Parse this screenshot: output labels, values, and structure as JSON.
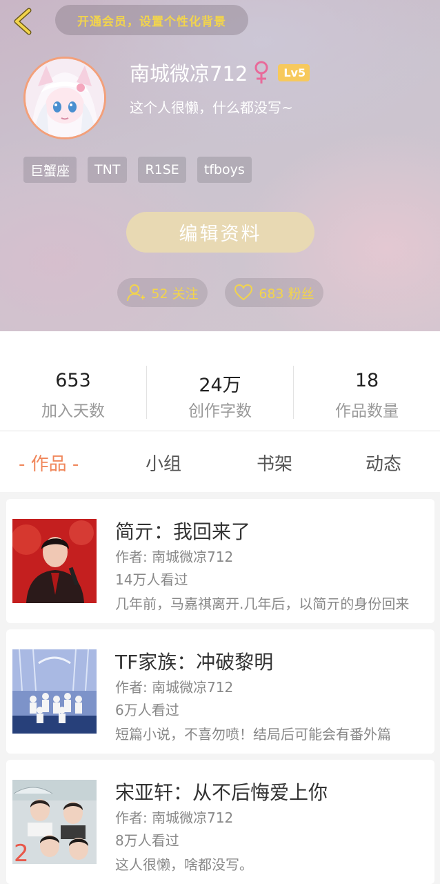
{
  "header": {
    "vip_text": "开通会员，设置个性化背景",
    "username": "南城微凉712",
    "gender_symbol": "♀",
    "level": "Lv5",
    "bio": "这个人很懒，什么都没写~",
    "tags": [
      "巨蟹座",
      "TNT",
      "R1SE",
      "tfboys"
    ],
    "edit_label": "编辑资料",
    "follow_text": "52 关注",
    "fans_text": "683 粉丝"
  },
  "stats": [
    {
      "value": "653",
      "label": "加入天数"
    },
    {
      "value": "24万",
      "label": "创作字数"
    },
    {
      "value": "18",
      "label": "作品数量"
    }
  ],
  "tabs": {
    "works": "- 作品 -",
    "groups": "小组",
    "bookshelf": "书架",
    "feed": "动态"
  },
  "works": [
    {
      "title": "简亓：我回来了",
      "author": "作者: 南城微凉712",
      "views": "14万人看过",
      "desc": "几年前，马嘉祺离开.几年后，以简亓的身份回来"
    },
    {
      "title": "TF家族：冲破黎明",
      "author": "作者: 南城微凉712",
      "views": "6万人看过",
      "desc": "短篇小说，不喜勿喷！结局后可能会有番外篇"
    },
    {
      "title": "宋亚轩：从不后悔爱上你",
      "author": "作者: 南城微凉712",
      "views": "8万人看过",
      "desc": "这人很懒，啥都没写。"
    }
  ],
  "colors": {
    "accent": "#f0865a",
    "gold": "#f2d44c",
    "level_badge": "#f7c95c",
    "edit_button": "#e8d9b3",
    "gender": "#e86a9a"
  }
}
